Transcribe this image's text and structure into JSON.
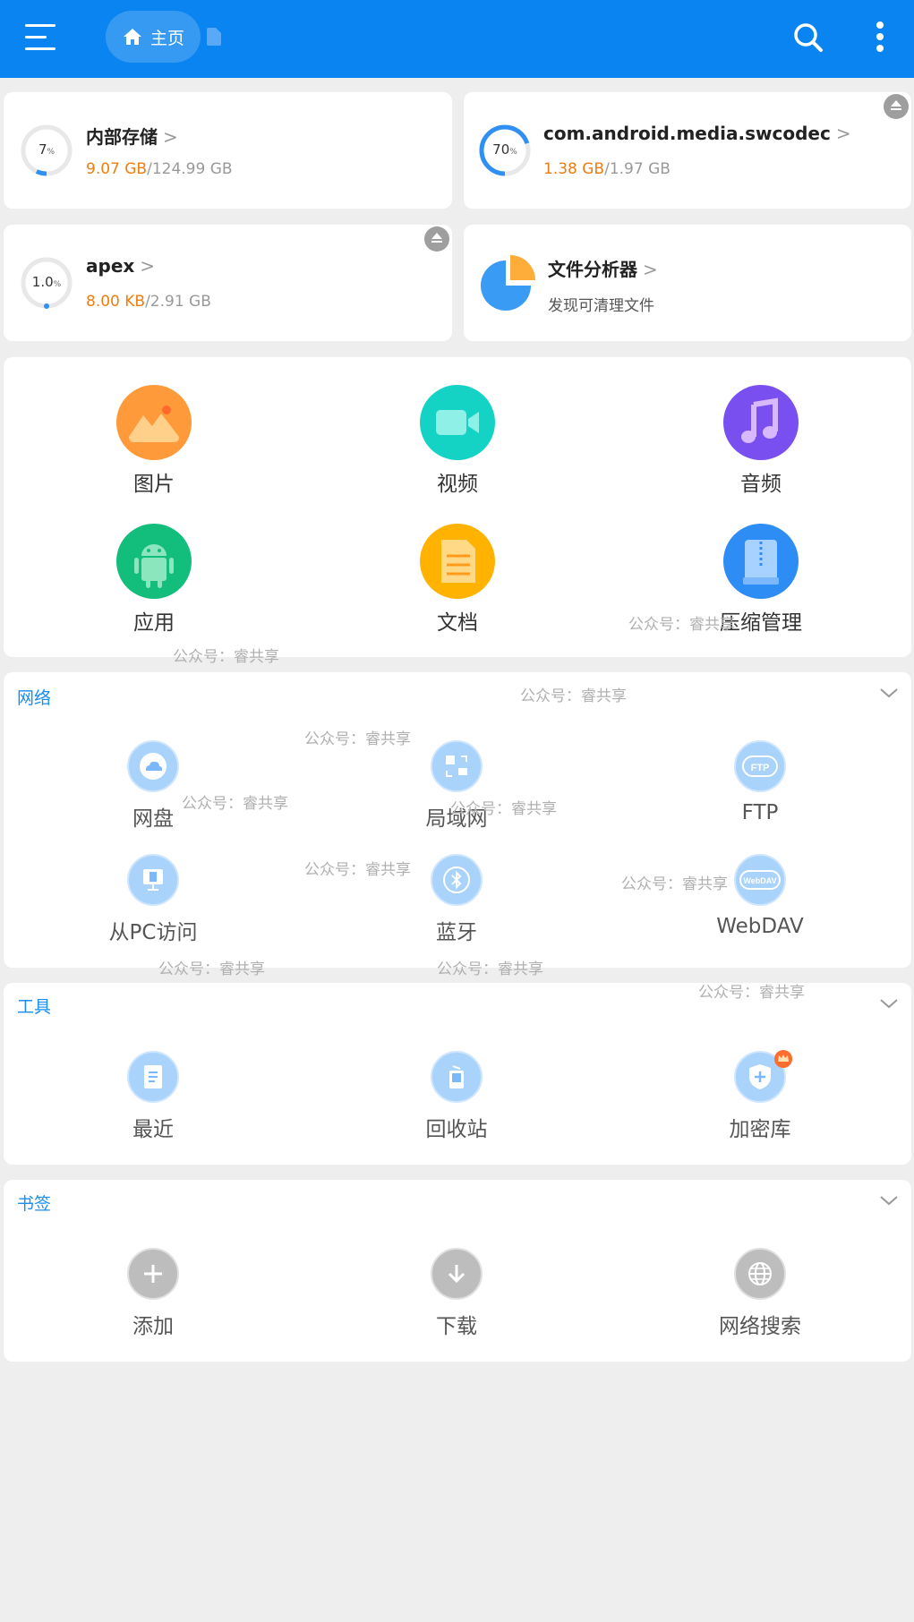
{
  "topbar": {
    "home_label": "主页"
  },
  "storage": [
    {
      "name": "内部存储",
      "percent": 7,
      "percent_text": "7",
      "unit": "%",
      "used": "9.07 GB",
      "total": "/124.99 GB",
      "ejectable": false
    },
    {
      "name": "com.android.media.swcodec",
      "percent": 70,
      "percent_text": "70",
      "unit": "%",
      "used": "1.38 GB",
      "total": "/1.97 GB",
      "ejectable": true
    },
    {
      "name": "apex",
      "percent": 1.0,
      "percent_text": "1.0",
      "unit": "%",
      "used": "8.00 KB",
      "total": "/2.91 GB",
      "ejectable": true
    }
  ],
  "analyzer": {
    "title": "文件分析器",
    "subtitle": "发现可清理文件"
  },
  "categories": [
    {
      "label": "图片",
      "icon": "image-icon",
      "color": "#ff9a3a"
    },
    {
      "label": "视频",
      "icon": "video-icon",
      "color": "#14d3c4"
    },
    {
      "label": "音频",
      "icon": "music-icon",
      "color": "#7a4ff0"
    },
    {
      "label": "应用",
      "icon": "android-icon",
      "color": "#13bd7c"
    },
    {
      "label": "文档",
      "icon": "document-icon",
      "color": "#ffb300"
    },
    {
      "label": "压缩管理",
      "icon": "archive-icon",
      "color": "#2e8df5"
    }
  ],
  "network": {
    "title": "网络",
    "items": [
      {
        "label": "网盘",
        "icon": "cloud-icon"
      },
      {
        "label": "局域网",
        "icon": "lan-icon"
      },
      {
        "label": "FTP",
        "icon": "ftp-icon",
        "badge": "FTP"
      },
      {
        "label": "从PC访问",
        "icon": "monitor-icon"
      },
      {
        "label": "蓝牙",
        "icon": "bluetooth-icon"
      },
      {
        "label": "WebDAV",
        "icon": "webdav-icon",
        "badge": "WebDAV"
      }
    ]
  },
  "tools": {
    "title": "工具",
    "items": [
      {
        "label": "最近",
        "icon": "recent-icon"
      },
      {
        "label": "回收站",
        "icon": "recycle-bin-icon"
      },
      {
        "label": "加密库",
        "icon": "vault-icon"
      }
    ]
  },
  "bookmarks": {
    "title": "书签",
    "items": [
      {
        "label": "添加",
        "icon": "plus-icon"
      },
      {
        "label": "下载",
        "icon": "download-icon"
      },
      {
        "label": "网络搜索",
        "icon": "globe-icon"
      }
    ]
  },
  "watermark": "公众号：睿共享",
  "colors": {
    "primary": "#0a84f0",
    "used_text": "#ef7d10",
    "section_title": "#1a8cf0"
  }
}
